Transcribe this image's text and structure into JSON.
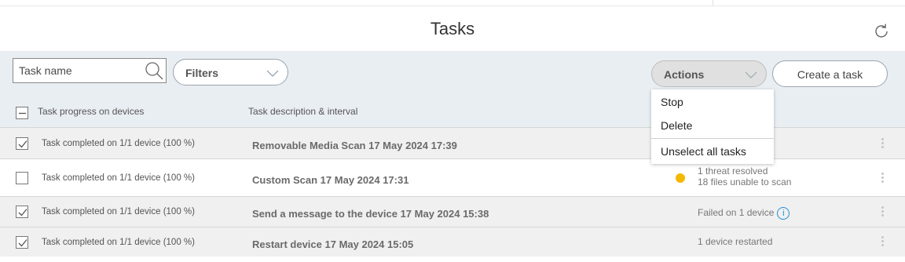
{
  "header": {
    "title": "Tasks",
    "refresh_icon": "refresh-icon"
  },
  "toolbar": {
    "search": {
      "placeholder": "Task name",
      "value": ""
    },
    "filters_label": "Filters",
    "actions_label": "Actions",
    "create_label": "Create a task"
  },
  "columns": {
    "progress": "Task progress on devices",
    "description": "Task description & interval"
  },
  "actions_menu": {
    "items": [
      "Stop",
      "Delete",
      "Unselect all tasks"
    ]
  },
  "colors": {
    "panel_bg": "#e9eef3",
    "selected_row_bg": "#f0f0f0",
    "warning_dot": "#f5b800",
    "info_blue": "#1f8fd6"
  },
  "rows": [
    {
      "checked": true,
      "progress": "Task completed on 1/1 device (100 %)",
      "description": "Removable Media Scan 17 May 2024 17:39",
      "result_line1": "",
      "result_line2": ""
    },
    {
      "checked": false,
      "progress": "Task completed on 1/1 device (100 %)",
      "description": "Custom Scan 17 May 2024 17:31",
      "result_line1": "1 threat resolved",
      "result_line2": "18 files unable to scan",
      "status_icon": "warning-dot"
    },
    {
      "checked": true,
      "progress": "Task completed on 1/1 device (100 %)",
      "description": "Send a message to the device 17 May 2024 15:38",
      "result_line1": "Failed on 1 device",
      "result_line2": "",
      "info_icon": "i"
    },
    {
      "checked": true,
      "progress": "Task completed on 1/1 device (100 %)",
      "description": "Restart device 17 May 2024 15:05",
      "result_line1": "1 device restarted",
      "result_line2": ""
    }
  ]
}
